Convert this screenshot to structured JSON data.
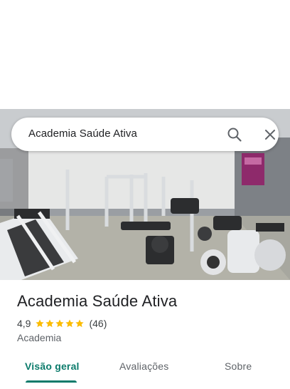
{
  "search": {
    "query": "Academia Saúde Ativa",
    "search_icon": "search-icon",
    "close_icon": "close-icon"
  },
  "place": {
    "name": "Academia Saúde Ativa",
    "rating": "4,9",
    "stars": 5,
    "review_count": "(46)",
    "category": "Academia"
  },
  "tabs": [
    {
      "label": "Visão geral",
      "active": true
    },
    {
      "label": "Avaliações",
      "active": false
    },
    {
      "label": "Sobre",
      "active": false
    }
  ],
  "colors": {
    "accent": "#0b7b6b",
    "star": "#fbbc04"
  }
}
